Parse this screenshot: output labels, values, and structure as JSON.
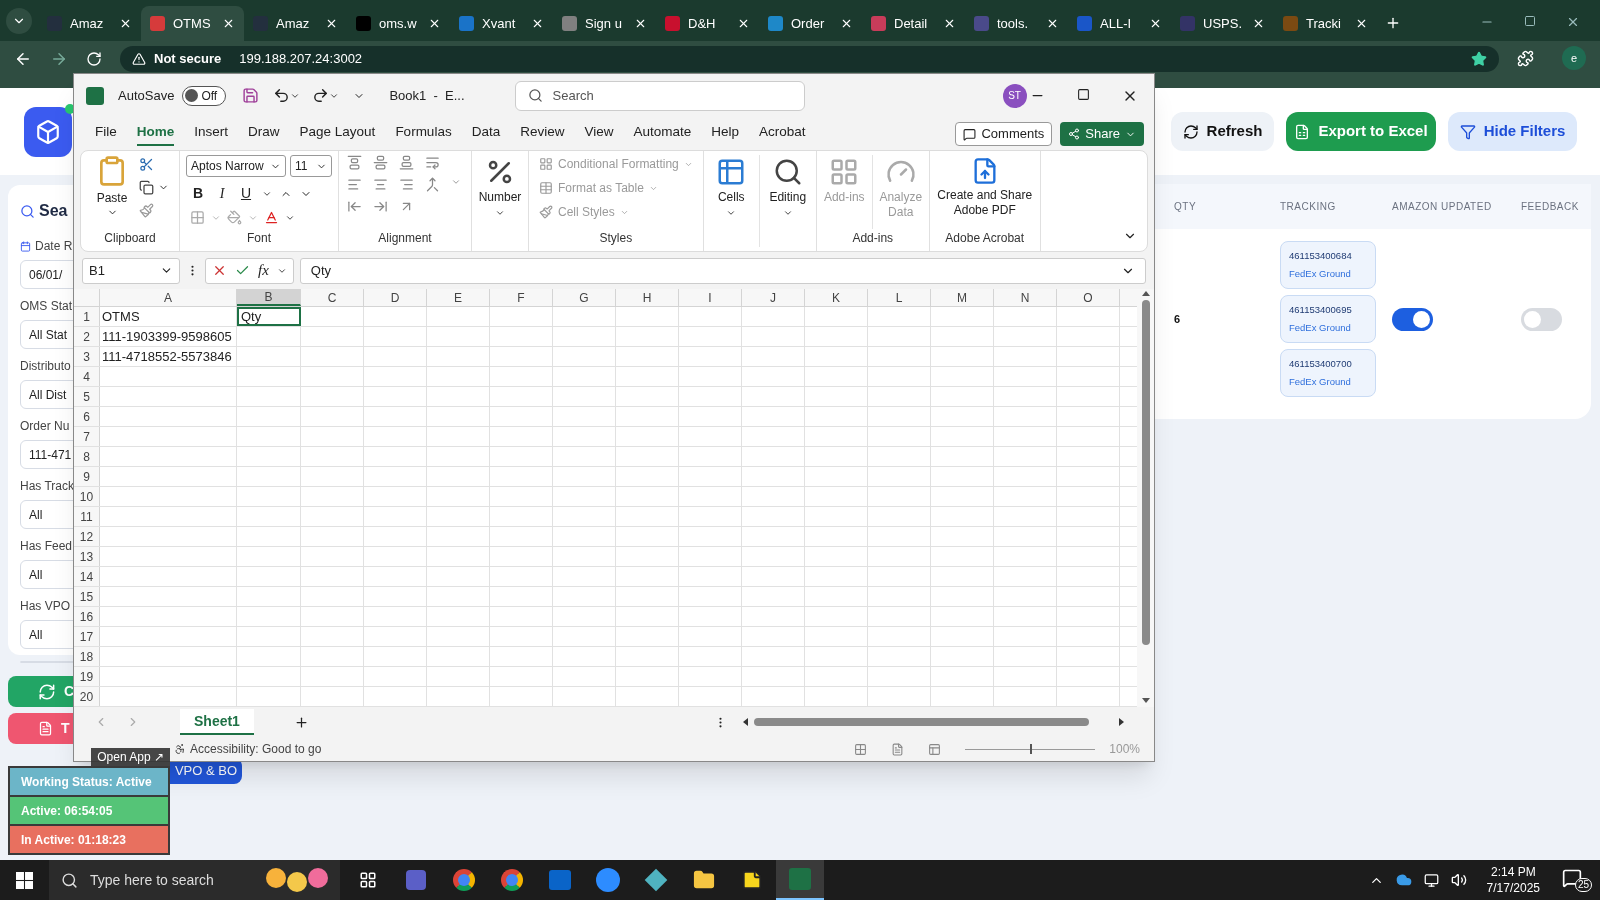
{
  "browser": {
    "tabs": [
      {
        "title": "Amaz",
        "color": "#232f3e",
        "selected": false
      },
      {
        "title": "OTMS",
        "color": "#d63b3b",
        "selected": true
      },
      {
        "title": "Amaz",
        "color": "#232f3e",
        "selected": false
      },
      {
        "title": "oms.w",
        "color": "#000000",
        "selected": false
      },
      {
        "title": "Xvant",
        "color": "#1a73c8",
        "selected": false
      },
      {
        "title": "Sign u",
        "color": "#808080",
        "selected": false
      },
      {
        "title": "D&H",
        "color": "#c8102e",
        "selected": false
      },
      {
        "title": "Order",
        "color": "#1e88c8",
        "selected": false
      },
      {
        "title": "Detail",
        "color": "#c83c5a",
        "selected": false
      },
      {
        "title": "tools.",
        "color": "#4a4a8a",
        "selected": false
      },
      {
        "title": "ALL-I",
        "color": "#1a56c8",
        "selected": false
      },
      {
        "title": "USPS.",
        "color": "#333366",
        "selected": false
      },
      {
        "title": "Tracki",
        "color": "#7b4a12",
        "selected": false
      }
    ],
    "security": "Not secure",
    "url": "199.188.207.24:3002",
    "profile": "e"
  },
  "page": {
    "filters": {
      "heading": "Sea",
      "fields": [
        {
          "label": "Date R",
          "value": "06/01/",
          "kind": "date"
        },
        {
          "label": "OMS Stat",
          "value": "All Stat",
          "kind": "select"
        },
        {
          "label": "Distributo",
          "value": "All Dist",
          "kind": "select"
        },
        {
          "label": "Order Nu",
          "value": "111-471",
          "kind": "input"
        },
        {
          "label": "Has Track",
          "value": "All",
          "kind": "select"
        },
        {
          "label": "Has Feed",
          "value": "All",
          "kind": "select"
        },
        {
          "label": "Has VPO",
          "value": "All",
          "kind": "select"
        },
        {
          "kind": "blank"
        }
      ]
    },
    "side_buttons": [
      {
        "label": "C",
        "kind": "sync"
      },
      {
        "label": "T",
        "kind": "report"
      }
    ],
    "upload_button": "VPO & BO",
    "actions": [
      {
        "label": "Refresh",
        "kind": "refresh"
      },
      {
        "label": "Export to Excel",
        "kind": "export"
      },
      {
        "label": "Hide Filters",
        "kind": "filter"
      }
    ],
    "table": {
      "columns": [
        "QTY",
        "TRACKING",
        "AMAZON UPDATED",
        "FEEDBACK"
      ],
      "rows": [
        {
          "qty": "6",
          "tracking": [
            {
              "number": "461153400684",
              "carrier": "FedEx Ground"
            },
            {
              "number": "461153400695",
              "carrier": "FedEx Ground"
            },
            {
              "number": "461153400700",
              "carrier": "FedEx Ground"
            }
          ],
          "amazon_updated": true,
          "feedback": false
        }
      ]
    }
  },
  "excel": {
    "autosave_label": "AutoSave",
    "autosave": {
      "on": false,
      "label": "Off"
    },
    "title": "Book1  -  E...",
    "search": {
      "placeholder": "Search"
    },
    "user": "ST",
    "menu": [
      {
        "label": "File",
        "selected": false
      },
      {
        "label": "Home",
        "selected": true
      },
      {
        "label": "Insert",
        "selected": false
      },
      {
        "label": "Draw",
        "selected": false
      },
      {
        "label": "Page Layout",
        "selected": false
      },
      {
        "label": "Formulas",
        "selected": false
      },
      {
        "label": "Data",
        "selected": false
      },
      {
        "label": "Review",
        "selected": false
      },
      {
        "label": "View",
        "selected": false
      },
      {
        "label": "Automate",
        "selected": false
      },
      {
        "label": "Help",
        "selected": false
      },
      {
        "label": "Acrobat",
        "selected": false
      }
    ],
    "comments": "Comments",
    "share": "Share",
    "ribbon": [
      {
        "kind": "clipboard",
        "label": "Clipboard",
        "paste": "Paste"
      },
      {
        "kind": "font",
        "label": "Font",
        "font": "Aptos Narrow",
        "size": "11",
        "styles": [
          "B",
          "I",
          "U"
        ]
      },
      {
        "kind": "alignment",
        "label": "Alignment"
      },
      {
        "kind": "large",
        "buttons": [
          {
            "label": "Number",
            "kind": "number",
            "disabled": false
          }
        ]
      },
      {
        "kind": "styles",
        "label": "Styles",
        "items": [
          {
            "label": "Conditional Formatting",
            "disabled": true
          },
          {
            "label": "Format as Table",
            "disabled": true
          },
          {
            "label": "Cell Styles",
            "disabled": true
          }
        ]
      },
      {
        "kind": "large",
        "buttons": [
          {
            "label": "Cells",
            "kind": "cells",
            "disabled": false
          },
          {
            "label": "Editing",
            "kind": "editing",
            "disabled": false
          }
        ]
      },
      {
        "kind": "large",
        "label": "Add-ins",
        "buttons": [
          {
            "label": "Add-ins",
            "kind": "addins",
            "disabled": true
          },
          {
            "label": "Analyze Data",
            "kind": "analyze",
            "disabled": true
          }
        ]
      },
      {
        "kind": "large",
        "label": "Adobe Acrobat",
        "buttons": [
          {
            "label": "Create and Share Adobe PDF",
            "kind": "pdf",
            "disabled": false
          }
        ]
      }
    ],
    "name_box": "B1",
    "fx": "fx",
    "formula": "Qty",
    "columns": [
      {
        "label": "A",
        "selected": false
      },
      {
        "label": "B",
        "selected": true
      },
      {
        "label": "C",
        "selected": false
      },
      {
        "label": "D",
        "selected": false
      },
      {
        "label": "E",
        "selected": false
      },
      {
        "label": "F",
        "selected": false
      },
      {
        "label": "G",
        "selected": false
      },
      {
        "label": "H",
        "selected": false
      },
      {
        "label": "I",
        "selected": false
      },
      {
        "label": "J",
        "selected": false
      },
      {
        "label": "K",
        "selected": false
      },
      {
        "label": "L",
        "selected": false
      },
      {
        "label": "M",
        "selected": false
      },
      {
        "label": "N",
        "selected": false
      },
      {
        "label": "O",
        "selected": false
      }
    ],
    "rows": [
      {
        "number": "1",
        "cells": [
          {
            "text": "OTMS",
            "selected": false
          },
          {
            "text": "Qty",
            "selected": true
          }
        ]
      },
      {
        "number": "2",
        "cells": [
          {
            "text": "111-1903399-9598605",
            "selected": false
          }
        ]
      },
      {
        "number": "3",
        "cells": [
          {
            "text": "111-4718552-5573846",
            "selected": false
          }
        ]
      },
      {
        "number": "4"
      },
      {
        "number": "5"
      },
      {
        "number": "6"
      },
      {
        "number": "7"
      },
      {
        "number": "8"
      },
      {
        "number": "9"
      },
      {
        "number": "10"
      },
      {
        "number": "11"
      },
      {
        "number": "12"
      },
      {
        "number": "13"
      },
      {
        "number": "14"
      },
      {
        "number": "15"
      },
      {
        "number": "16"
      },
      {
        "number": "17"
      },
      {
        "number": "18"
      },
      {
        "number": "19"
      },
      {
        "number": "20"
      }
    ],
    "sheets": [
      {
        "label": "Sheet1",
        "selected": true
      }
    ],
    "status": "Accessibility: Good to go",
    "zoom": {
      "level": 0.5,
      "label": "100%"
    }
  },
  "tracker": {
    "open": "Open App ↗",
    "rows": [
      {
        "label": "Working Status: Active",
        "color": "#6cb5c8"
      },
      {
        "label": "Active: 06:54:05",
        "color": "#55c477"
      },
      {
        "label": "In Active: 01:18:23",
        "color": "#e8705f"
      }
    ]
  },
  "taskbar": {
    "search": {
      "placeholder": "Type here to search"
    },
    "apps": [
      {
        "kind": "taskview",
        "selected": false
      },
      {
        "kind": "teams",
        "selected": false
      },
      {
        "kind": "chrome",
        "selected": false
      },
      {
        "kind": "chrome",
        "selected": false
      },
      {
        "kind": "outlook",
        "selected": false
      },
      {
        "kind": "zoom",
        "selected": false
      },
      {
        "kind": "app",
        "selected": false
      },
      {
        "kind": "folder",
        "selected": false
      },
      {
        "kind": "notes",
        "selected": false
      },
      {
        "kind": "excel",
        "selected": true
      }
    ],
    "time": "2:14 PM",
    "date": "7/17/2025",
    "notifications": "25"
  }
}
